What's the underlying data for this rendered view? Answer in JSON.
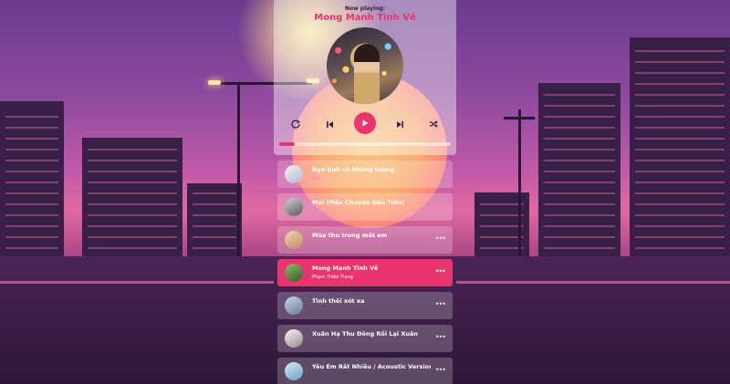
{
  "player": {
    "now_playing_label": "Now playing:",
    "current_title": "Mong Manh Tình Về",
    "progress_fraction": 0.09
  },
  "colors": {
    "accent": "#e8356d",
    "panel": "rgba(255,255,255,0.42)"
  },
  "icons": {
    "repeat": "repeat-icon",
    "prev": "previous-icon",
    "play": "play-icon",
    "next": "next-icon",
    "shuffle": "shuffle-icon",
    "more": "more-icon"
  },
  "playlist": [
    {
      "title": "Bạn tình cờ không tưởng",
      "artist": "Bon",
      "active": false
    },
    {
      "title": "Mai (Mầu Chuyện Đầu Tiên)",
      "artist": "",
      "active": false
    },
    {
      "title": "Mùa thu trong mắt em",
      "artist": "",
      "active": false
    },
    {
      "title": "Mong Manh Tình Về",
      "artist": "Phạm Thiên Trang",
      "active": true
    },
    {
      "title": "Tình thôi xót xa",
      "artist": "",
      "active": false
    },
    {
      "title": "Xuân Hạ Thu Đông Rồi Lại Xuân",
      "artist": "",
      "active": false
    },
    {
      "title": "Yêu Em Rất Nhiều / Acoustic Version",
      "artist": "",
      "active": false
    }
  ]
}
